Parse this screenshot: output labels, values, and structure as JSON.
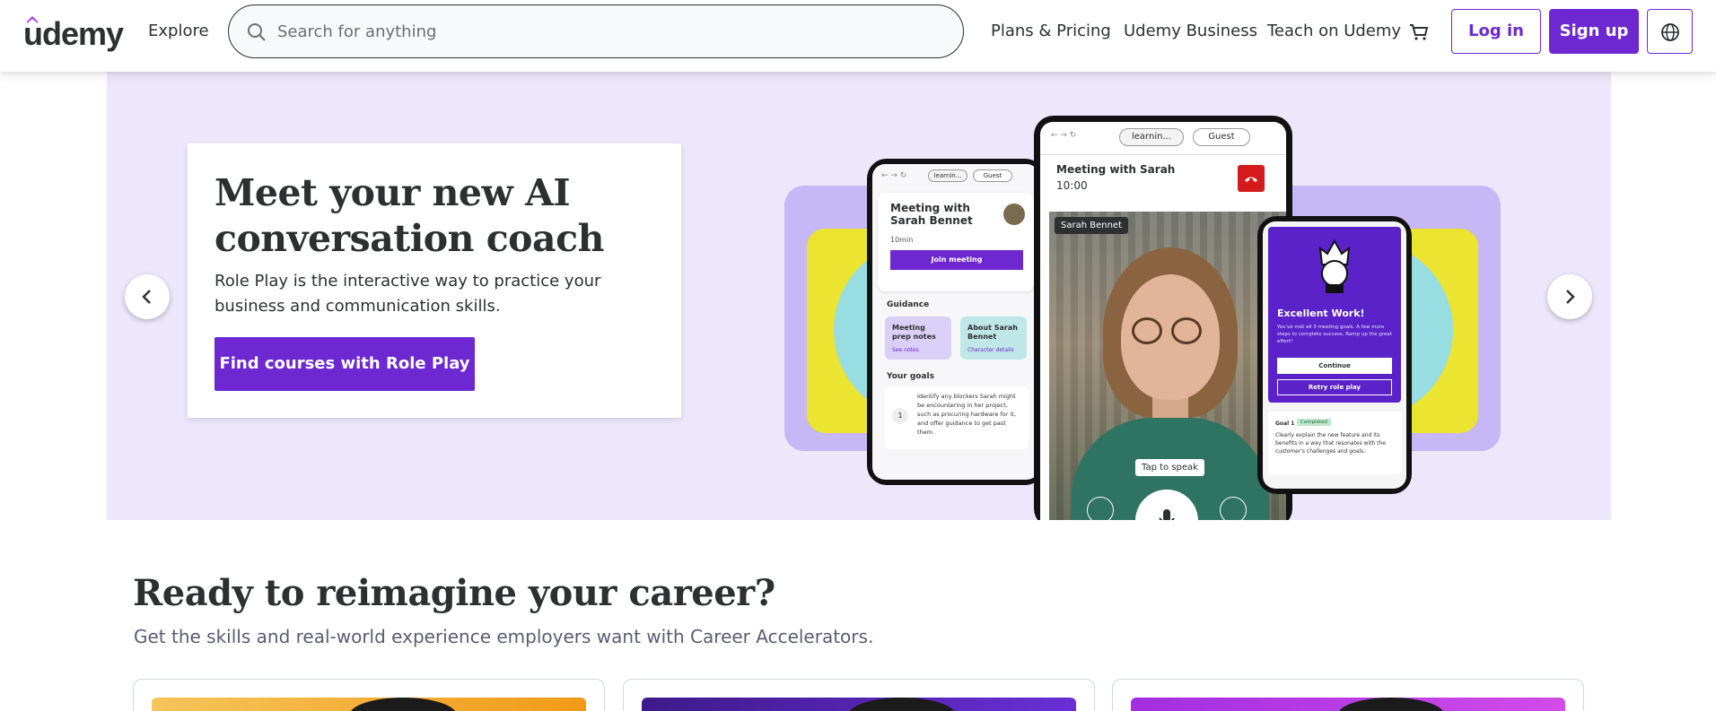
{
  "header": {
    "logo_text": "udemy",
    "explore": "Explore",
    "search_placeholder": "Search for anything",
    "nav": [
      "Plans & Pricing",
      "Udemy Business",
      "Teach on Udemy"
    ],
    "login": "Log in",
    "signup": "Sign up",
    "brand_color": "#6d28d2"
  },
  "hero": {
    "title": "Meet your new AI conversation coach",
    "description": "Role Play is the interactive way to practice your business and communication skills.",
    "cta": "Find courses with Role Play",
    "illustration": {
      "left_phone": {
        "url": "learnin...",
        "guest": "Guest",
        "meeting_title": "Meeting with Sarah Bennet",
        "duration": "10min",
        "join": "Join meeting",
        "guidance": "Guidance",
        "card1_title": "Meeting prep notes",
        "card1_link": "See notes",
        "card2_title": "About Sarah Bennet",
        "card2_link": "Character details",
        "goals_title": "Your goals",
        "goal_num": "1",
        "goal_text": "Identify any blockers Sarah might be encountering in her project, such as procuring hardware for it, and offer guidance to get past them."
      },
      "center_phone": {
        "url": "learnin...",
        "guest": "Guest",
        "meeting_title": "Meeting with Sarah",
        "time": "10:00",
        "name_tag": "Sarah Bennet",
        "tap_to_speak": "Tap to speak"
      },
      "right_phone": {
        "heading": "Excellent Work!",
        "body": "You've met all 3 meeting goals. A few more steps to complete success. Ramp up the great effort!",
        "continue": "Continue",
        "retry": "Retry role play",
        "goal_label": "Goal 1",
        "goal_badge": "Completed",
        "goal_text": "Clearly explain the new feature and its benefits in a way that resonates with the customer's challenges and goals."
      }
    }
  },
  "career": {
    "title": "Ready to reimagine your career?",
    "subtitle": "Get the skills and real-world experience employers want with Career Accelerators."
  }
}
